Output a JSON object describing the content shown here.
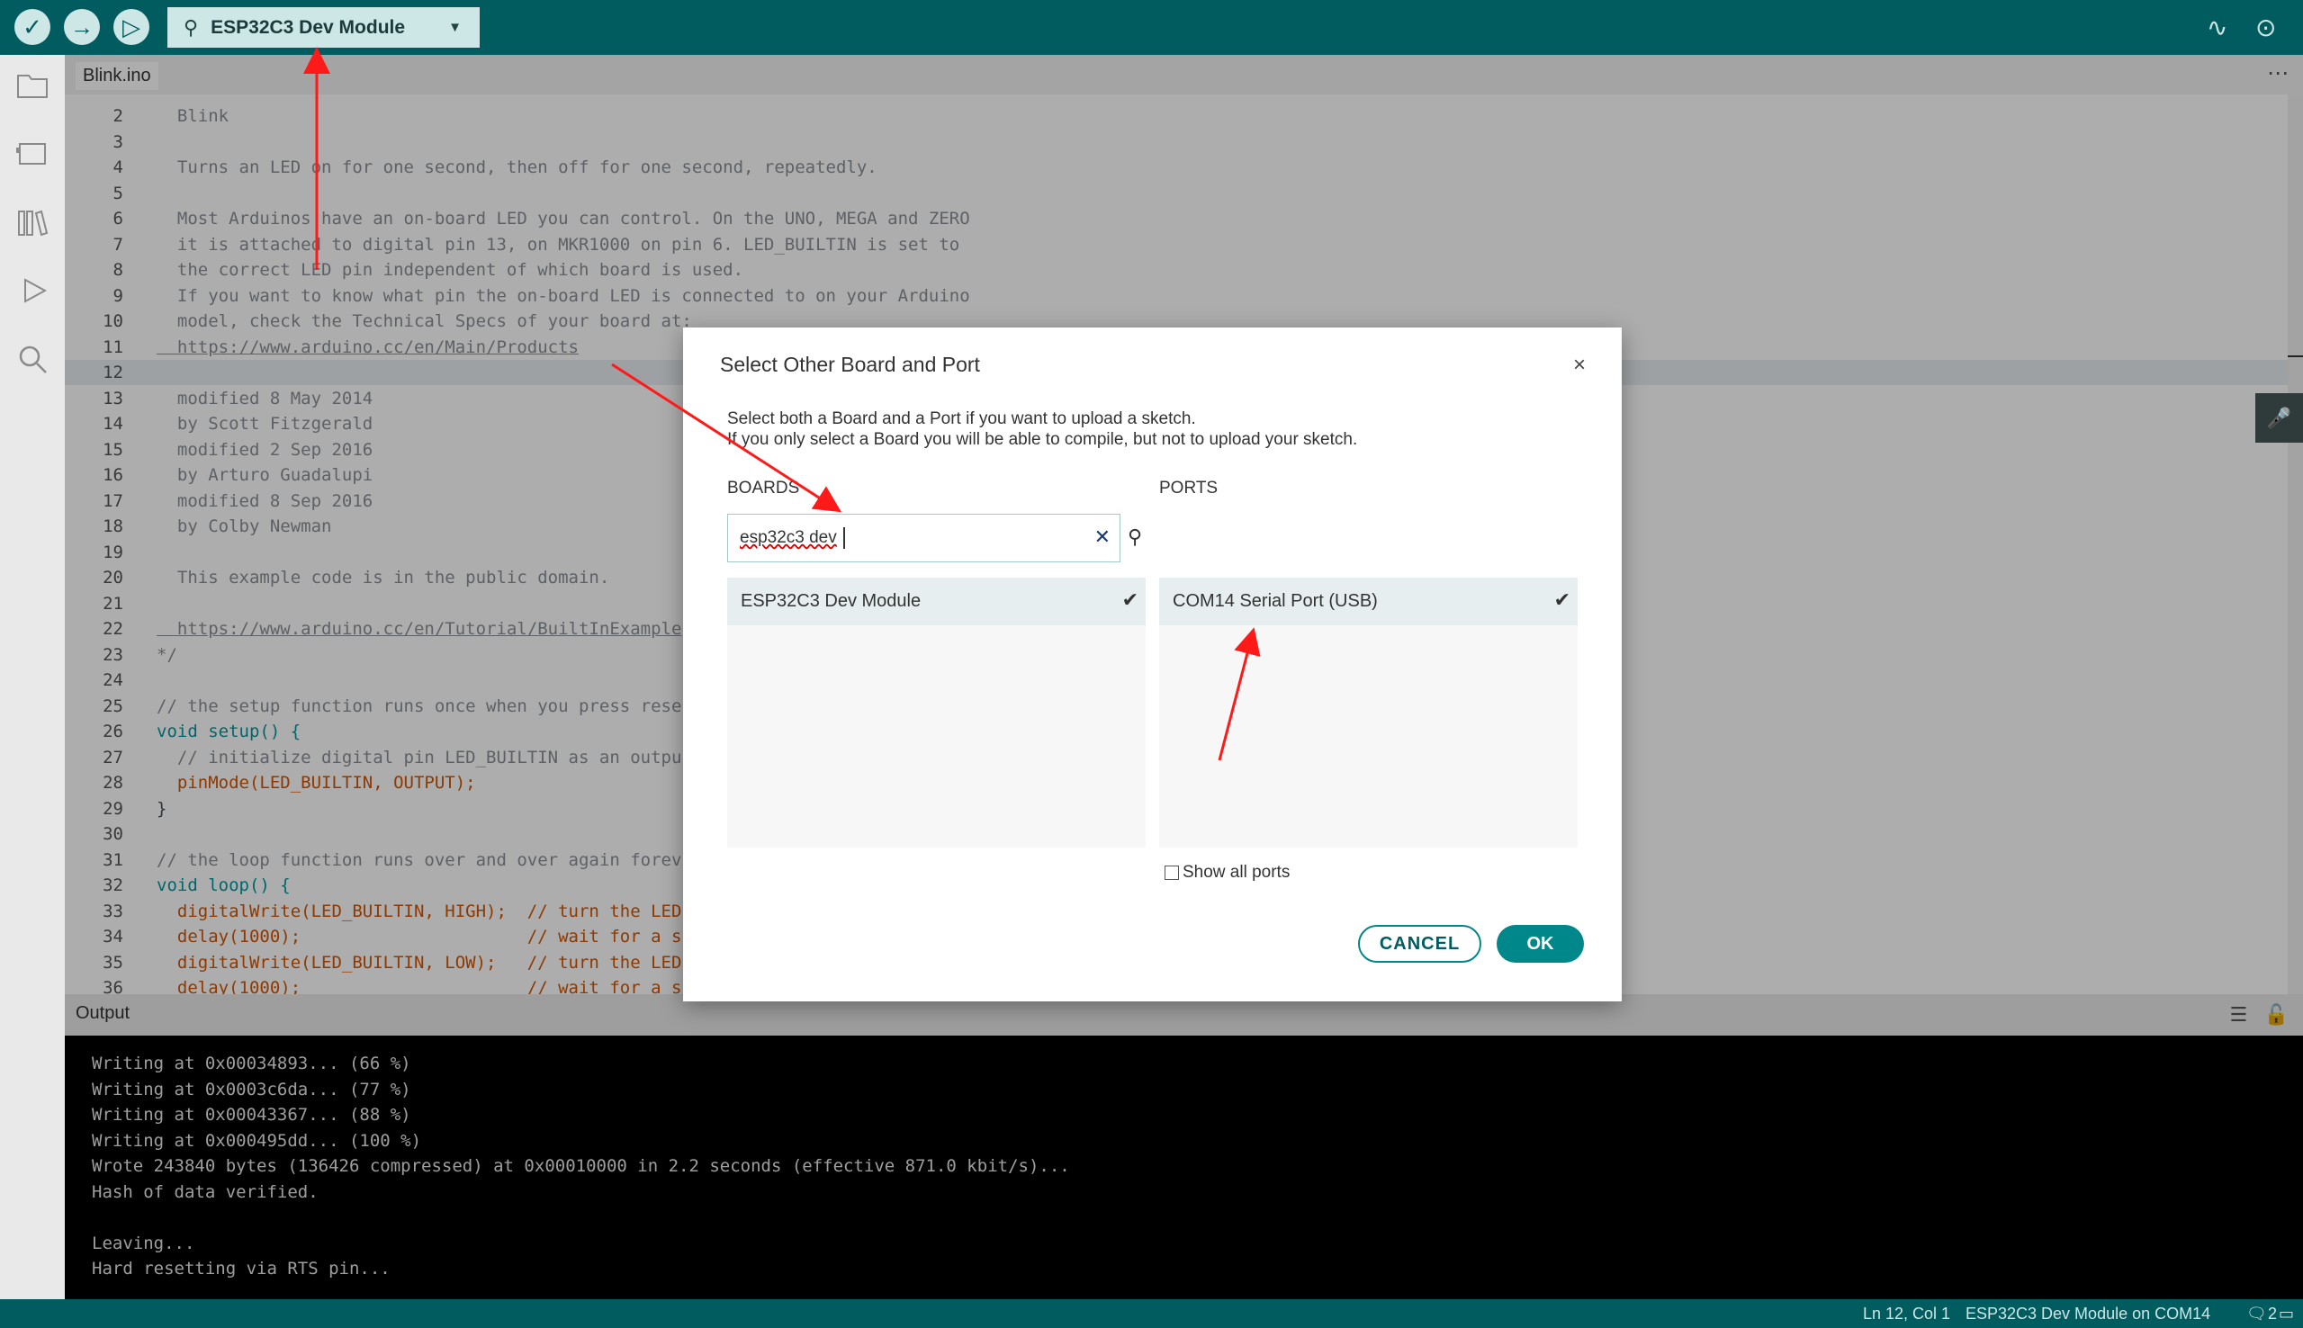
{
  "toolbar": {
    "board_name": "ESP32C3 Dev Module",
    "verify_glyph": "✓",
    "upload_glyph": "→",
    "debug_glyph": "▷",
    "serial_plotter_glyph": "∿",
    "serial_monitor_glyph": "⊙"
  },
  "tabs": {
    "file_name": "Blink.ino",
    "more_glyph": "⋯"
  },
  "editor": {
    "lines": [
      {
        "n": "2",
        "text": "  Blink",
        "kind": "comment"
      },
      {
        "n": "3",
        "text": "",
        "kind": "comment"
      },
      {
        "n": "4",
        "text": "  Turns an LED on for one second, then off for one second, repeatedly.",
        "kind": "comment"
      },
      {
        "n": "5",
        "text": "",
        "kind": "comment"
      },
      {
        "n": "6",
        "text": "  Most Arduinos have an on-board LED you can control. On the UNO, MEGA and ZERO",
        "kind": "comment"
      },
      {
        "n": "7",
        "text": "  it is attached to digital pin 13, on MKR1000 on pin 6. LED_BUILTIN is set to",
        "kind": "comment"
      },
      {
        "n": "8",
        "text": "  the correct LED pin independent of which board is used.",
        "kind": "comment"
      },
      {
        "n": "9",
        "text": "  If you want to know what pin the on-board LED is connected to on your Arduino",
        "kind": "comment"
      },
      {
        "n": "10",
        "text": "  model, check the Technical Specs of your board at:",
        "kind": "comment"
      },
      {
        "n": "11",
        "text": "  https://www.arduino.cc/en/Main/Products",
        "kind": "link"
      },
      {
        "n": "12",
        "text": "",
        "kind": "comment"
      },
      {
        "n": "13",
        "text": "  modified 8 May 2014",
        "kind": "comment"
      },
      {
        "n": "14",
        "text": "  by Scott Fitzgerald",
        "kind": "comment"
      },
      {
        "n": "15",
        "text": "  modified 2 Sep 2016",
        "kind": "comment"
      },
      {
        "n": "16",
        "text": "  by Arturo Guadalupi",
        "kind": "comment"
      },
      {
        "n": "17",
        "text": "  modified 8 Sep 2016",
        "kind": "comment"
      },
      {
        "n": "18",
        "text": "  by Colby Newman",
        "kind": "comment"
      },
      {
        "n": "19",
        "text": "",
        "kind": "comment"
      },
      {
        "n": "20",
        "text": "  This example code is in the public domain.",
        "kind": "comment"
      },
      {
        "n": "21",
        "text": "",
        "kind": "comment"
      },
      {
        "n": "22",
        "text": "  https://www.arduino.cc/en/Tutorial/BuiltInExample",
        "kind": "link"
      },
      {
        "n": "23",
        "text": "*/",
        "kind": "comment"
      },
      {
        "n": "24",
        "text": "",
        "kind": "plain"
      },
      {
        "n": "25",
        "text": "// the setup function runs once when you press rese",
        "kind": "comment"
      },
      {
        "n": "26",
        "text": "void setup() {",
        "kind": "kw"
      },
      {
        "n": "27",
        "text": "  // initialize digital pin LED_BUILTIN as an outpu",
        "kind": "comment"
      },
      {
        "n": "28",
        "text": "  pinMode(LED_BUILTIN, OUTPUT);",
        "kind": "fn"
      },
      {
        "n": "29",
        "text": "}",
        "kind": "plain"
      },
      {
        "n": "30",
        "text": "",
        "kind": "plain"
      },
      {
        "n": "31",
        "text": "// the loop function runs over and over again forev",
        "kind": "comment"
      },
      {
        "n": "32",
        "text": "void loop() {",
        "kind": "kw"
      },
      {
        "n": "33",
        "text": "  digitalWrite(LED_BUILTIN, HIGH);  // turn the LED",
        "kind": "fn"
      },
      {
        "n": "34",
        "text": "  delay(1000);                      // wait for a s",
        "kind": "fn"
      },
      {
        "n": "35",
        "text": "  digitalWrite(LED_BUILTIN, LOW);   // turn the LED",
        "kind": "fn"
      },
      {
        "n": "36",
        "text": "  delay(1000);                      // wait for a s",
        "kind": "fn"
      }
    ],
    "highlight_line": "12"
  },
  "output": {
    "title": "Output",
    "lines": [
      "Writing at 0x00034893... (66 %)",
      "Writing at 0x0003c6da... (77 %)",
      "Writing at 0x00043367... (88 %)",
      "Writing at 0x000495dd... (100 %)",
      "Wrote 243840 bytes (136426 compressed) at 0x00010000 in 2.2 seconds (effective 871.0 kbit/s)...",
      "Hash of data verified.",
      "",
      "Leaving...",
      "Hard resetting via RTS pin..."
    ]
  },
  "statusbar": {
    "position": "Ln 12, Col 1",
    "board_port": "ESP32C3 Dev Module on COM14",
    "count": "2"
  },
  "dialog": {
    "title": "Select Other Board and Port",
    "close_glyph": "×",
    "desc_line1": "Select both a Board and a Port if you want to upload a sketch.",
    "desc_line2": "If you only select a Board you will be able to compile, but not to upload your sketch.",
    "boards_label": "BOARDS",
    "ports_label": "PORTS",
    "search_value": "esp32c3 dev",
    "board_item": "ESP32C3 Dev Module",
    "port_item": "COM14 Serial Port (USB)",
    "show_all_ports": "Show all ports",
    "cancel_label": "CANCEL",
    "ok_label": "OK"
  },
  "colors": {
    "teal_dark": "#005c5f",
    "teal_accent": "#00878a",
    "annotation_red": "#ff1a1a"
  }
}
